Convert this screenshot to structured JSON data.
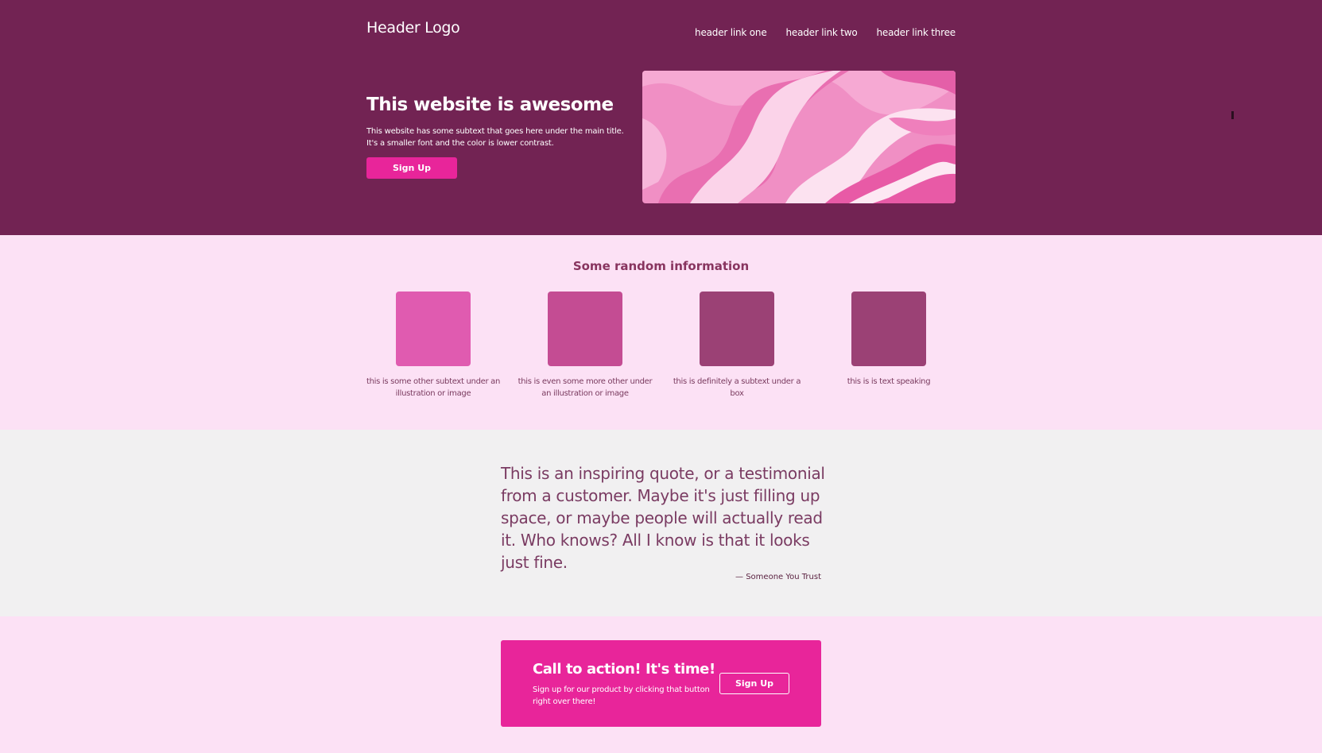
{
  "header": {
    "logo": "Header Logo",
    "links": [
      "header link one",
      "header link two",
      "header link three"
    ]
  },
  "hero": {
    "title": "This website is awesome",
    "subtitle": "This website has some subtext that goes here under the main title. It's a smaller font and the color is lower contrast.",
    "button_label": "Sign Up",
    "image_icon": "pink-marble-image"
  },
  "info": {
    "title": "Some random information",
    "cards": [
      {
        "caption": "this is some other subtext under an illustration or image",
        "color": "#e05bb0"
      },
      {
        "caption": "this is even some more other under an illustration or image",
        "color": "#c44c93"
      },
      {
        "caption": "this is definitely a subtext under a box",
        "color": "#9b4175"
      },
      {
        "caption": "this is is text speaking",
        "color": "#9b4175"
      }
    ]
  },
  "quote": {
    "text": "This is an inspiring quote, or a testimonial from a customer. Maybe it's just filling up space, or maybe people will actually read it. Who knows? All I know is that it looks just fine.",
    "author": "— Someone You Trust"
  },
  "cta": {
    "title": "Call to action! It's time!",
    "subtitle": "Sign up for our product by clicking that button right over there!",
    "button_label": "Sign Up"
  },
  "colors": {
    "hero_bg": "#722353",
    "accent": "#e8259a",
    "light_bg": "#fce1f5",
    "quote_bg": "#f1f0f1"
  }
}
